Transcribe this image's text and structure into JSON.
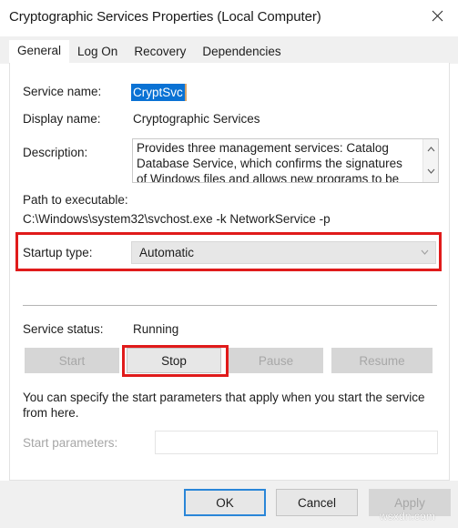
{
  "window": {
    "title": "Cryptographic Services Properties (Local Computer)",
    "close_icon": "close-icon"
  },
  "tabs": [
    {
      "label": "General",
      "active": true
    },
    {
      "label": "Log On",
      "active": false
    },
    {
      "label": "Recovery",
      "active": false
    },
    {
      "label": "Dependencies",
      "active": false
    }
  ],
  "general": {
    "service_name_label": "Service name:",
    "service_name_value": "CryptSvc",
    "display_name_label": "Display name:",
    "display_name_value": "Cryptographic Services",
    "description_label": "Description:",
    "description_value": "Provides three management services: Catalog Database Service, which confirms the signatures of Windows files and allows new programs to be",
    "path_label": "Path to executable:",
    "path_value": "C:\\Windows\\system32\\svchost.exe -k NetworkService -p",
    "startup_type_label": "Startup type:",
    "startup_type_value": "Automatic",
    "service_status_label": "Service status:",
    "service_status_value": "Running",
    "buttons": [
      {
        "label": "Start",
        "enabled": false
      },
      {
        "label": "Stop",
        "enabled": true
      },
      {
        "label": "Pause",
        "enabled": false
      },
      {
        "label": "Resume",
        "enabled": false
      }
    ],
    "hint_text": "You can specify the start parameters that apply when you start the service from here.",
    "start_parameters_label": "Start parameters:",
    "start_parameters_value": ""
  },
  "footer": {
    "ok_label": "OK",
    "cancel_label": "Cancel",
    "apply_label": "Apply"
  },
  "watermark": "wsxdn.com",
  "colors": {
    "highlight_red": "#e01b1b",
    "selection_blue": "#0a72d4",
    "focus_blue": "#2a86d8"
  }
}
